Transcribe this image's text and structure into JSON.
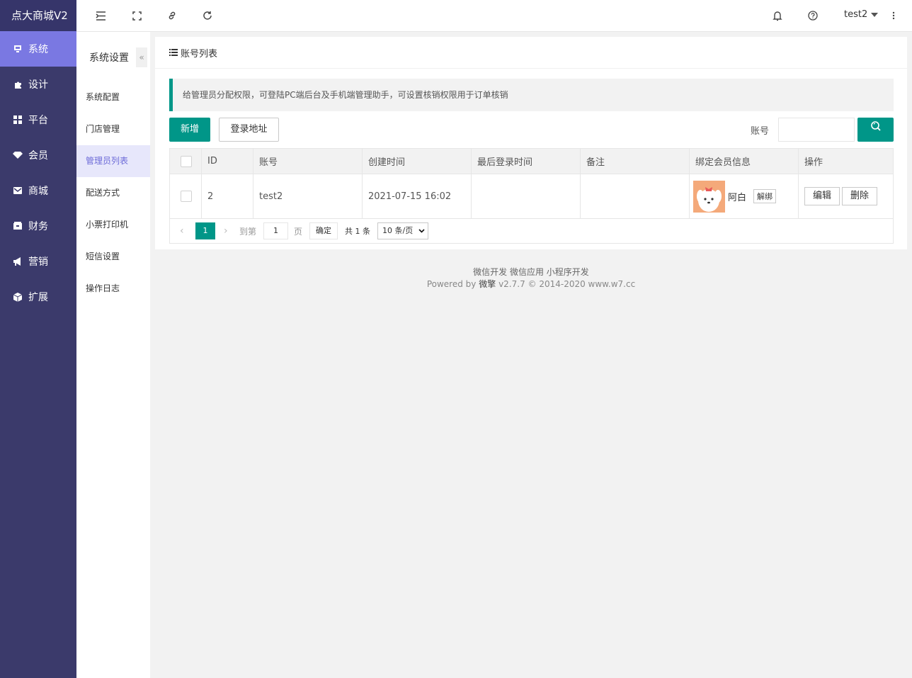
{
  "brand": "点大商城V2",
  "sidebar": {
    "items": [
      {
        "label": "系统",
        "icon": "monitor-icon"
      },
      {
        "label": "设计",
        "icon": "puzzle-icon"
      },
      {
        "label": "平台",
        "icon": "grid-icon"
      },
      {
        "label": "会员",
        "icon": "diamond-icon"
      },
      {
        "label": "商城",
        "icon": "mail-icon"
      },
      {
        "label": "财务",
        "icon": "wallet-icon"
      },
      {
        "label": "营销",
        "icon": "megaphone-icon"
      },
      {
        "label": "扩展",
        "icon": "cube-icon"
      }
    ]
  },
  "topbar": {
    "user": "test2"
  },
  "subnav": {
    "title": "系统设置",
    "collapse": "«",
    "items": [
      "系统配置",
      "门店管理",
      "管理员列表",
      "配送方式",
      "小票打印机",
      "短信设置",
      "操作日志"
    ]
  },
  "card": {
    "title": "账号列表",
    "notice": "给管理员分配权限，可登陆PC端后台及手机端管理助手，可设置核销权限用于订单核销",
    "add_label": "新增",
    "login_label": "登录地址",
    "search_label": "账号",
    "search_value": ""
  },
  "table": {
    "headers": [
      "ID",
      "账号",
      "创建时间",
      "最后登录时间",
      "备注",
      "绑定会员信息",
      "操作"
    ],
    "rows": [
      {
        "id": "2",
        "account": "test2",
        "created": "2021-07-15 16:02",
        "last_login": "",
        "remark": "",
        "member_name": "阿白",
        "unbind": "解绑",
        "edit": "编辑",
        "delete": "删除"
      }
    ]
  },
  "pager": {
    "current": "1",
    "goto_label": "到第",
    "goto_value": "1",
    "page_label": "页",
    "confirm": "确定",
    "total": "共 1 条",
    "size": "10 条/页"
  },
  "footer": {
    "line1": "微信开发 微信应用 小程序开发",
    "powered": "Powered by",
    "brand": "微擎",
    "version": "v2.7.7 © 2014-2020 www.w7.cc"
  },
  "colors": {
    "sidebar": "#3b3a6b",
    "active": "#7a78e2",
    "primary": "#009688"
  }
}
